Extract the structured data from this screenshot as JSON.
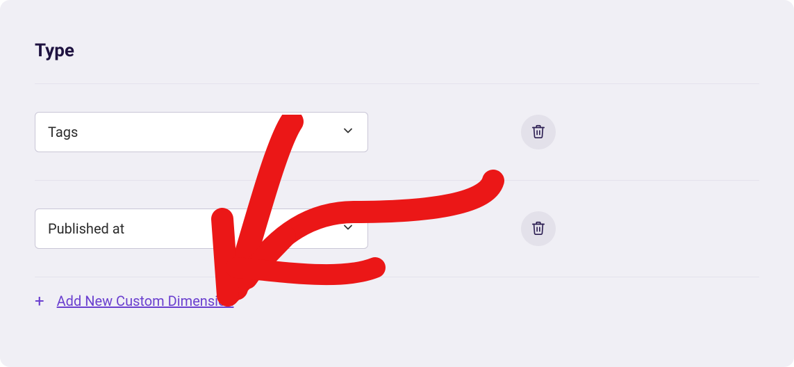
{
  "heading": "Type",
  "rows": [
    {
      "label": "Tags"
    },
    {
      "label": "Published at"
    }
  ],
  "addLink": "Add New Custom Dimension"
}
